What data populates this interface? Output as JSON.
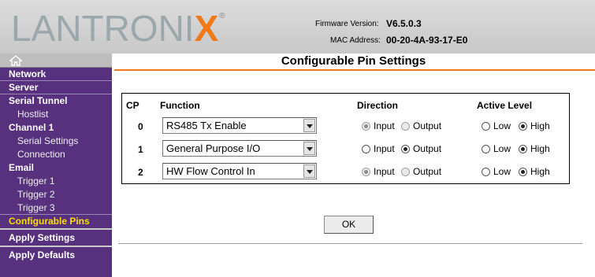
{
  "header": {
    "logo_text": "LANTRONIX",
    "logo_x": "X",
    "logo_reg": "®",
    "firmware_label": "Firmware Version:",
    "firmware_value": "V6.5.0.3",
    "mac_label": "MAC Address:",
    "mac_value": "00-20-4A-93-17-E0",
    "logo_gray_color": "#9aa8ac",
    "logo_orange_color": "#f07a1a"
  },
  "sidebar": {
    "home_icon": "home-icon",
    "items": [
      {
        "label": "Network"
      },
      {
        "label": "Server"
      },
      {
        "label": "Serial Tunnel"
      },
      {
        "label": "Hostlist"
      },
      {
        "label": "Channel 1"
      },
      {
        "label": "Serial Settings"
      },
      {
        "label": "Connection"
      },
      {
        "label": "Email"
      },
      {
        "label": "Trigger 1"
      },
      {
        "label": "Trigger 2"
      },
      {
        "label": "Trigger 3"
      },
      {
        "label": "Configurable Pins"
      },
      {
        "label": "Apply Settings"
      },
      {
        "label": "Apply Defaults"
      }
    ],
    "active_item": "Configurable Pins",
    "bg_color": "#57317d",
    "active_color": "#ffdd00"
  },
  "page": {
    "title": "Configurable Pin Settings",
    "accent_color": "#f07a1a"
  },
  "table": {
    "headers": {
      "cp": "CP",
      "function": "Function",
      "direction": "Direction",
      "active_level": "Active Level"
    },
    "rows": [
      {
        "cp": "0",
        "function": "RS485 Tx Enable",
        "direction_input": "Input",
        "direction_output": "Output",
        "direction_selected": "Input",
        "direction_disabled": true,
        "level_low": "Low",
        "level_high": "High",
        "level_selected": "High"
      },
      {
        "cp": "1",
        "function": "General Purpose I/O",
        "direction_input": "Input",
        "direction_output": "Output",
        "direction_selected": "Output",
        "direction_disabled": false,
        "level_low": "Low",
        "level_high": "High",
        "level_selected": "High"
      },
      {
        "cp": "2",
        "function": "HW Flow Control In",
        "direction_input": "Input",
        "direction_output": "Output",
        "direction_selected": "Input",
        "direction_disabled": true,
        "level_low": "Low",
        "level_high": "High",
        "level_selected": "High"
      }
    ]
  },
  "actions": {
    "ok_label": "OK"
  }
}
